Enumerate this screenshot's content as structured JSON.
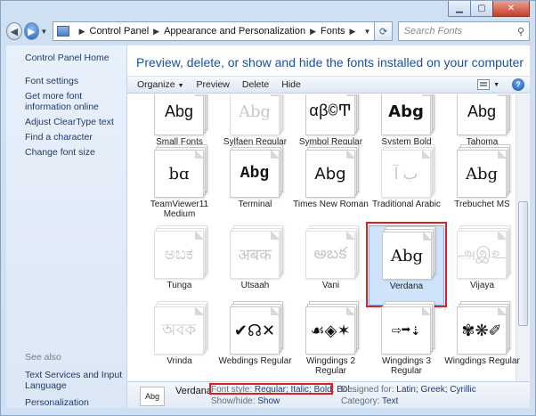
{
  "address": {
    "crumbs": [
      "Control Panel",
      "Appearance and Personalization",
      "Fonts"
    ],
    "search_placeholder": "Search Fonts"
  },
  "left_nav": {
    "home": "Control Panel Home",
    "links": [
      "Font settings",
      "Get more font information online",
      "Adjust ClearType text",
      "Find a character",
      "Change font size"
    ],
    "see_also_header": "See also",
    "see_also": [
      "Text Services and Input Language",
      "Personalization"
    ]
  },
  "heading": "Preview, delete, or show and hide the fonts installed on your computer",
  "commands": {
    "organize": "Organize",
    "preview": "Preview",
    "delete": "Delete",
    "hide": "Hide"
  },
  "fonts": [
    {
      "name": "Small Fonts Regular",
      "sample": "Abg",
      "hidden": false
    },
    {
      "name": "Sylfaen Regular",
      "sample": "Abg",
      "hidden": true
    },
    {
      "name": "Symbol Regular",
      "sample": "αβ©Ͳ",
      "hidden": false
    },
    {
      "name": "System Bold",
      "sample": "Abg",
      "hidden": false
    },
    {
      "name": "Tahoma",
      "sample": "Abg",
      "hidden": false
    },
    {
      "name": "TeamViewer11 Medium",
      "sample": "bɑ",
      "hidden": false
    },
    {
      "name": "Terminal",
      "sample": "Abg",
      "hidden": false
    },
    {
      "name": "Times New Roman",
      "sample": "Abg",
      "hidden": false
    },
    {
      "name": "Traditional Arabic",
      "sample": "ب آ",
      "hidden": true
    },
    {
      "name": "Trebuchet MS",
      "sample": "Abg",
      "hidden": false
    },
    {
      "name": "Tunga",
      "sample": "ಅಬಕ",
      "hidden": true
    },
    {
      "name": "Utsaah",
      "sample": "अबक",
      "hidden": true
    },
    {
      "name": "Vani",
      "sample": "అబక",
      "hidden": true
    },
    {
      "name": "Verdana",
      "sample": "Abg",
      "hidden": false
    },
    {
      "name": "Vijaya",
      "sample": "அஇஉ",
      "hidden": true
    },
    {
      "name": "Vrinda",
      "sample": "অবক",
      "hidden": true
    },
    {
      "name": "Webdings Regular",
      "sample": "✔☊✕",
      "hidden": false
    },
    {
      "name": "Wingdings 2 Regular",
      "sample": "☙◈✶",
      "hidden": false
    },
    {
      "name": "Wingdings 3 Regular",
      "sample": "⇨➡⇣",
      "hidden": false
    },
    {
      "name": "Wingdings Regular",
      "sample": "✾❋✐",
      "hidden": false
    }
  ],
  "selected_font_index": 13,
  "details": {
    "name": "Verdana",
    "icon_sample": "Abg",
    "font_style_label": "Font style:",
    "font_style_value": "Regular; Italic; Bold; Bol...",
    "designed_for_label": "Designed for:",
    "designed_for_value": "Latin; Greek; Cyrillic",
    "show_hide_label": "Show/hide:",
    "show_hide_value": "Show",
    "category_label": "Category:",
    "category_value": "Text"
  }
}
